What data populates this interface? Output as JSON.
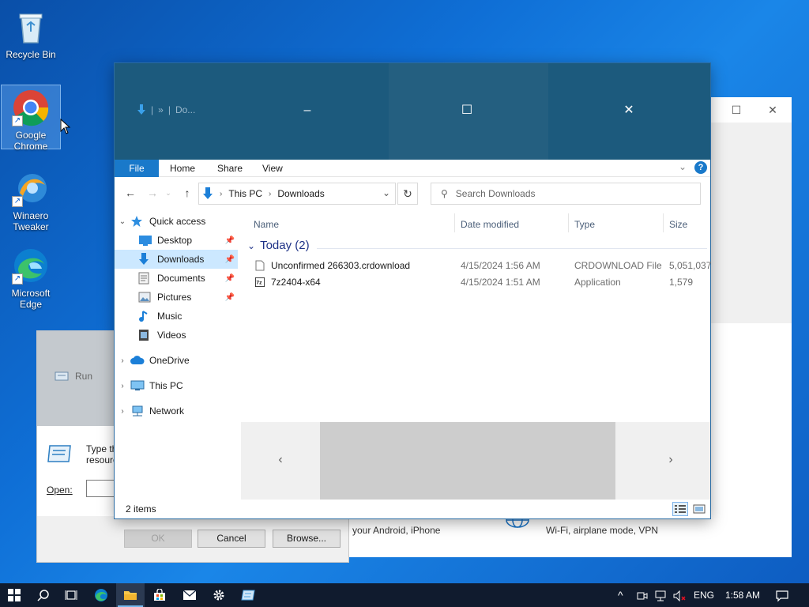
{
  "desktop": {
    "icons": [
      {
        "label": "Recycle Bin"
      },
      {
        "label": "Google Chrome"
      },
      {
        "label": "Winaero Tweaker"
      },
      {
        "label": "Microsoft Edge"
      }
    ]
  },
  "settings": {
    "phone_text": "your Android, iPhone",
    "network_text": "Wi-Fi, airplane mode, VPN"
  },
  "run": {
    "title": "Run",
    "desc_line1": "Type th",
    "desc_line2": "resourc",
    "open_label": "Open:",
    "ok_label": "OK",
    "cancel_label": "Cancel",
    "browse_label": "Browse..."
  },
  "explorer": {
    "title_short": "Do...",
    "ribbon": {
      "file": "File",
      "home": "Home",
      "share": "Share",
      "view": "View"
    },
    "breadcrumb": [
      "This PC",
      "Downloads"
    ],
    "search_placeholder": "Search Downloads",
    "nav": {
      "quick_access": "Quick access",
      "desktop": "Desktop",
      "downloads": "Downloads",
      "documents": "Documents",
      "pictures": "Pictures",
      "music": "Music",
      "videos": "Videos",
      "onedrive": "OneDrive",
      "this_pc": "This PC",
      "network": "Network"
    },
    "columns": {
      "name": "Name",
      "date": "Date modified",
      "type": "Type",
      "size": "Size"
    },
    "group": "Today (2)",
    "files": [
      {
        "name": "Unconfirmed 266303.crdownload",
        "date": "4/15/2024 1:56 AM",
        "type": "CRDOWNLOAD File",
        "size": "5,051,037"
      },
      {
        "name": "7z2404-x64",
        "date": "4/15/2024 1:51 AM",
        "type": "Application",
        "size": "1,579"
      }
    ],
    "status": "2 items"
  },
  "taskbar": {
    "lang": "ENG",
    "time": "1:58 AM"
  },
  "colors": {
    "accent": "#1979ca",
    "titlebar": "#1c5a7d",
    "taskbar": "#101b2e"
  }
}
